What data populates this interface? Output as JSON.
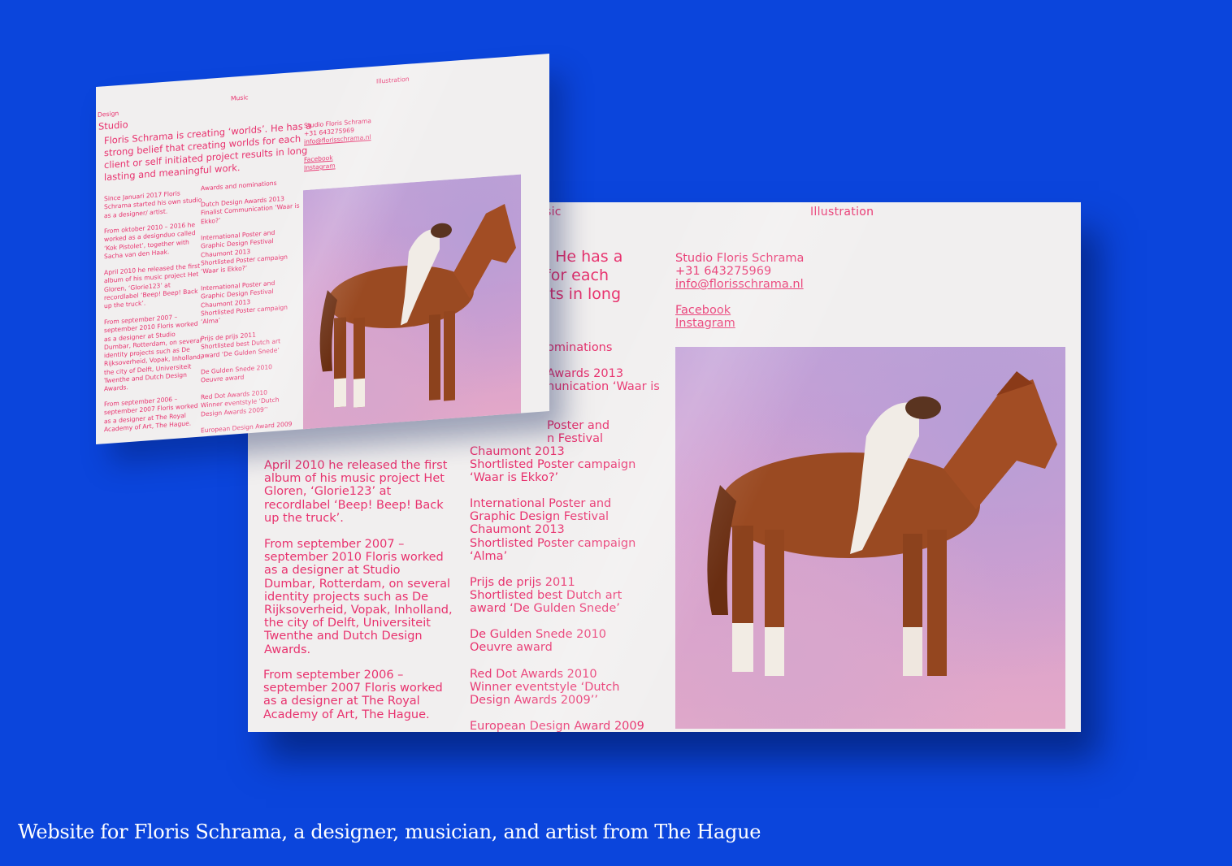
{
  "caption": "Website for Floris Schrama, a designer, musician, and artist from The Hague",
  "colors": {
    "background": "#0b45dc",
    "accent": "#e8326e",
    "paper": "#f1efef"
  },
  "front": {
    "nav_music": "sic",
    "nav_illustration": "Illustration",
    "intro": ". He has a\nfor each\nlts in long",
    "contact": {
      "studio": "Studio Floris Schrama",
      "phone": "+31 643275969",
      "email": "info@florisschrama.nl",
      "facebook": "Facebook",
      "instagram": "Instagram"
    },
    "awards_heading": "ominations",
    "awards_partial": "Awards 2013\nnunication ‘Waar is",
    "awards_partial2": "Poster and\nn Festival",
    "chaumont_cut": "Chaumont 2013",
    "award_items": [
      "Shortlisted Poster campaign\n‘Waar is Ekko?’",
      "International Poster and\nGraphic Design Festival\nChaumont 2013\nShortlisted Poster campaign\n‘Alma’",
      "Prijs de prijs 2011\nShortlisted best Dutch art\naward ‘De Gulden Snede’",
      "De Gulden Snede 2010\nOeuvre award",
      "Red Dot Awards 2010\nWinner eventstyle ‘Dutch\nDesign Awards 2009’’",
      "European Design Award 2009"
    ],
    "bio_items": [
      "April 2010 he released the first\nalbum of his music project Het\nGloren, ‘Glorie123’ at\nrecordlabel ‘Beep! Beep! Back\nup the truck’.",
      "From september 2007 –\nseptember 2010 Floris worked\nas a designer at Studio\nDumbar, Rotterdam, on several\nidentity projects such as De\nRijksoverheid, Vopak, Inholland,\nthe city of Delft, Universiteit\nTwenthe and Dutch Design\nAwards.",
      "From september 2006 –\nseptember 2007 Floris worked\nas a designer at The Royal\nAcademy of Art, The Hague."
    ]
  },
  "back": {
    "nav_design": "Design",
    "nav_studio": "Studio",
    "nav_music": "Music",
    "nav_illustration": "Illustration",
    "intro": "Floris Schrama is creating ‘worlds’. He has a\nstrong belief that creating worlds for each\nclient or self initiated project results in long\nlasting and meaningful work.",
    "contact": {
      "studio": "Studio Floris Schrama",
      "phone": "+31 643275969",
      "email": "info@florisschrama.nl",
      "facebook": "Facebook",
      "instagram": "Instagram"
    },
    "bio_items": [
      "Since Januari 2017 Floris\nSchrama started his own studio\nas a designer/ artist.",
      "From oktober 2010 – 2016 he\nworked as a designduo called\n‘Kok Pistolet’, together with\nSacha van den Haak.",
      "April 2010 he released the first\nalbum of his music project Het\nGloren, ‘Glorie123’ at\nrecordlabel ‘Beep! Beep! Back\nup the truck’.",
      "From september 2007 –\nseptember 2010 Floris worked\nas a designer at Studio\nDumbar, Rotterdam, on several\nidentity projects such as De\nRijksoverheid, Vopak, Inholland,\nthe city of Delft, Universiteit\nTwenthe and Dutch Design\nAwards.",
      "From september 2006 –\nseptember 2007 Floris worked\nas a designer at The Royal\nAcademy of Art, The Hague."
    ],
    "awards_heading": "Awards and nominations",
    "award_items": [
      "Dutch Design Awards 2013\nFinalist Communication ‘Waar is\nEkko?’",
      "International Poster and\nGraphic Design Festival\nChaumont 2013\nShortlisted Poster campaign\n‘Waar is Ekko?’",
      "International Poster and\nGraphic Design Festival\nChaumont 2013\nShortlisted Poster campaign\n‘Alma’",
      "Prijs de prijs 2011\nShortlisted best Dutch art\naward ‘De Gulden Snede’",
      "De Gulden Snede 2010\nOeuvre award",
      "Red Dot Awards 2010\nWinner eventstyle ‘Dutch\nDesign Awards 2009’’",
      "European Design Award 2009"
    ]
  }
}
